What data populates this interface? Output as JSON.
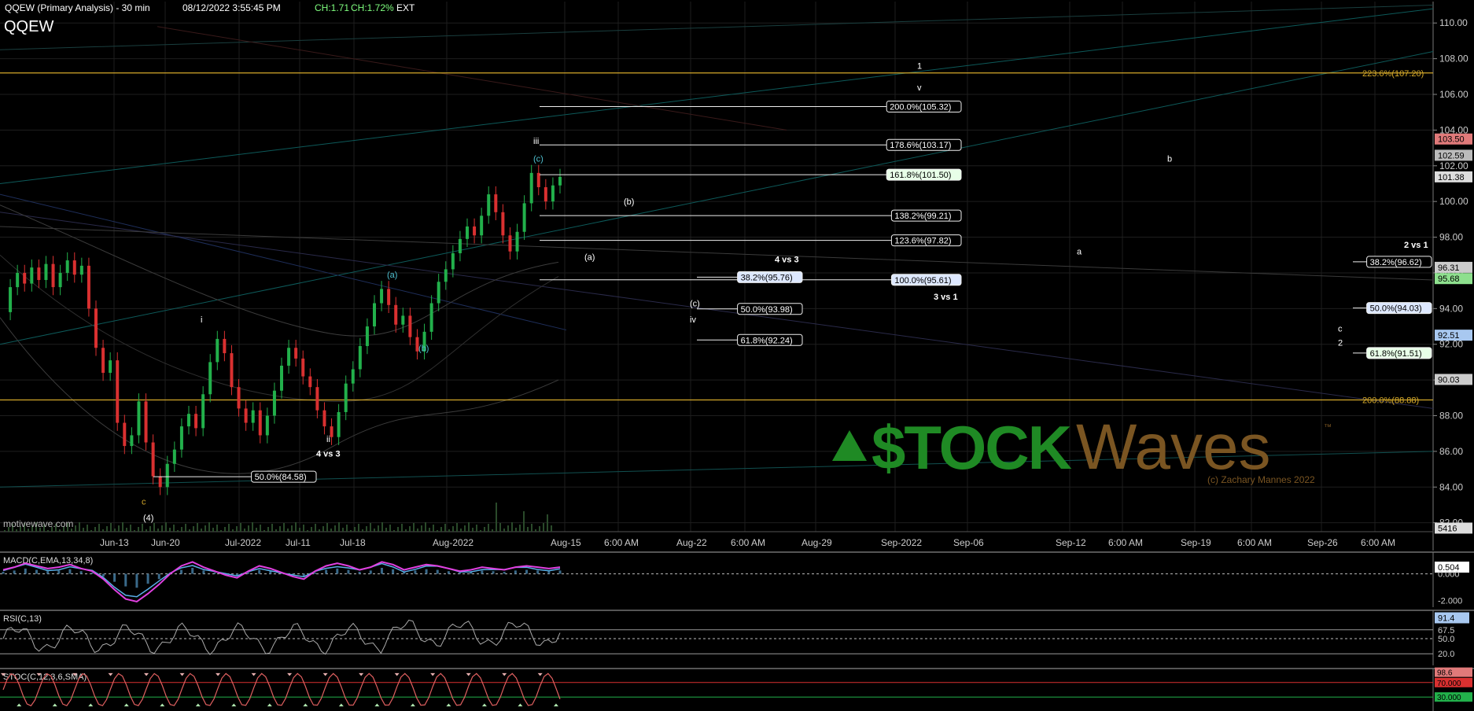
{
  "header": {
    "title": "QQEW (Primary Analysis) - 30 min",
    "timestamp": "08/12/2022 3:55:45 PM",
    "change_abs": "CH:1.71",
    "change_pct": "CH:1.72%",
    "session": "EXT",
    "symbol": "QQEW"
  },
  "watermark": {
    "credit": "motivewave.com",
    "brand_left": "$TOCK",
    "brand_right": "Waves",
    "trademark": "™",
    "copyright": "(c) Zachary Mannes 2022"
  },
  "colors": {
    "background": "#000000",
    "up": "#22b04b",
    "down": "#d93030",
    "fib_gold": "#d4a82a",
    "cyan_label": "#4fc0d0",
    "brand_green": "#1f8a24",
    "brand_brown": "#7a5522",
    "macd": "#e040e0",
    "macd_signal": "#5aaee8"
  },
  "chart_data": [
    {
      "type": "line",
      "name": "price",
      "x_ticks": [
        "Jun-13",
        "Jun-20",
        "Jul-2022",
        "Jul-11",
        "Jul-18",
        "Aug-2022",
        "Aug-15",
        "6:00 AM",
        "Aug-22",
        "6:00 AM",
        "Aug-29",
        "Sep-2022",
        "Sep-06",
        "Sep-12",
        "6:00 AM",
        "Sep-19",
        "6:00 AM",
        "Sep-26",
        "6:00 AM"
      ],
      "y_ticks": [
        82,
        84,
        86,
        88,
        90,
        92,
        94,
        96,
        98,
        100,
        102,
        104,
        106,
        108,
        110
      ],
      "y_tick_labels": [
        "82.00",
        "84.00",
        "86.00",
        "88.00",
        "90.00",
        "92.00",
        "94.00",
        "96.00",
        "98.00",
        "100.00",
        "102.00",
        "104.00",
        "106.00",
        "108.00",
        "110.00"
      ],
      "ylim": [
        81.5,
        111.2
      ],
      "axis_badges": [
        {
          "label": "103.50",
          "value": 103.5,
          "bg": "#e07a7a",
          "fg": "#000000"
        },
        {
          "label": "102.59",
          "value": 102.59,
          "bg": "#bbbbbb",
          "fg": "#000000"
        },
        {
          "label": "101.38",
          "value": 101.38,
          "bg": "#dddddd",
          "fg": "#000000"
        },
        {
          "label": "96.31",
          "value": 96.31,
          "bg": "#cccccc",
          "fg": "#000000"
        },
        {
          "label": "95.68",
          "value": 95.68,
          "bg": "#8ee08e",
          "fg": "#000000"
        },
        {
          "label": "92.51",
          "value": 92.51,
          "bg": "#a8c8f0",
          "fg": "#000000"
        },
        {
          "label": "90.03",
          "value": 90.03,
          "bg": "#cccccc",
          "fg": "#000000"
        },
        {
          "label": "5416",
          "value": 81.7,
          "bg": "#dddddd",
          "fg": "#000000"
        }
      ],
      "horizontal_levels": [
        {
          "label": "223.6%(107.20)",
          "value": 107.2,
          "color": "#d4a82a"
        },
        {
          "label": "200.0%(88.88)",
          "value": 88.88,
          "color": "#d4a82a"
        }
      ],
      "fib_levels": [
        {
          "label": "200.0%(105.32)",
          "value": 105.32
        },
        {
          "label": "178.6%(103.17)",
          "value": 103.17
        },
        {
          "label": "161.8%(101.50)",
          "value": 101.5
        },
        {
          "label": "138.2%(99.21)",
          "value": 99.21
        },
        {
          "label": "123.6%(97.82)",
          "value": 97.82
        },
        {
          "label": "100.0%(95.61)",
          "value": 95.61
        },
        {
          "label": "38.2%(95.76)",
          "value": 95.76
        },
        {
          "label": "50.0%(93.98)",
          "value": 93.98
        },
        {
          "label": "61.8%(92.24)",
          "value": 92.24
        },
        {
          "label": "50.0%(84.58)",
          "value": 84.58
        },
        {
          "label": "38.2%(96.62)",
          "value": 96.62
        },
        {
          "label": "50.0%(94.03)",
          "value": 94.03
        },
        {
          "label": "61.8%(91.51)",
          "value": 91.51
        }
      ],
      "wave_labels": [
        "1",
        "v",
        "iii",
        "(c)",
        "(b)",
        "(a)",
        "(a)",
        "(b)",
        "i",
        "ii",
        "c",
        "(4)",
        "(c)",
        "iv",
        "b",
        "a",
        "c",
        "2"
      ],
      "text_annotations": [
        "4 vs 3",
        "3 vs 1",
        "4 vs 3",
        "2 vs 1"
      ],
      "price_path": [
        {
          "t": 0,
          "v": 93.8
        },
        {
          "t": 1,
          "v": 95.2
        },
        {
          "t": 2,
          "v": 96.0
        },
        {
          "t": 3,
          "v": 95.4
        },
        {
          "t": 4,
          "v": 96.3
        },
        {
          "t": 5,
          "v": 95.6
        },
        {
          "t": 6,
          "v": 96.5
        },
        {
          "t": 7,
          "v": 95.2
        },
        {
          "t": 8,
          "v": 96.0
        },
        {
          "t": 9,
          "v": 96.7
        },
        {
          "t": 10,
          "v": 95.9
        },
        {
          "t": 11,
          "v": 96.4
        },
        {
          "t": 12,
          "v": 94.0
        },
        {
          "t": 13,
          "v": 91.8
        },
        {
          "t": 14,
          "v": 90.4
        },
        {
          "t": 15,
          "v": 91.1
        },
        {
          "t": 16,
          "v": 87.6
        },
        {
          "t": 17,
          "v": 86.3
        },
        {
          "t": 18,
          "v": 86.9
        },
        {
          "t": 19,
          "v": 88.8
        },
        {
          "t": 20,
          "v": 86.5
        },
        {
          "t": 21,
          "v": 84.6
        },
        {
          "t": 22,
          "v": 84.0
        },
        {
          "t": 23,
          "v": 85.3
        },
        {
          "t": 24,
          "v": 86.1
        },
        {
          "t": 25,
          "v": 87.4
        },
        {
          "t": 26,
          "v": 88.1
        },
        {
          "t": 27,
          "v": 87.3
        },
        {
          "t": 28,
          "v": 89.2
        },
        {
          "t": 29,
          "v": 91.0
        },
        {
          "t": 30,
          "v": 92.3
        },
        {
          "t": 31,
          "v": 91.5
        },
        {
          "t": 32,
          "v": 89.6
        },
        {
          "t": 33,
          "v": 88.4
        },
        {
          "t": 34,
          "v": 87.6
        },
        {
          "t": 35,
          "v": 88.3
        },
        {
          "t": 36,
          "v": 86.9
        },
        {
          "t": 37,
          "v": 88.0
        },
        {
          "t": 38,
          "v": 89.4
        },
        {
          "t": 39,
          "v": 90.8
        },
        {
          "t": 40,
          "v": 91.8
        },
        {
          "t": 41,
          "v": 91.2
        },
        {
          "t": 42,
          "v": 90.2
        },
        {
          "t": 43,
          "v": 89.6
        },
        {
          "t": 44,
          "v": 88.3
        },
        {
          "t": 45,
          "v": 87.4
        },
        {
          "t": 46,
          "v": 86.8
        },
        {
          "t": 47,
          "v": 88.2
        },
        {
          "t": 48,
          "v": 89.8
        },
        {
          "t": 49,
          "v": 90.6
        },
        {
          "t": 50,
          "v": 91.9
        },
        {
          "t": 51,
          "v": 93.0
        },
        {
          "t": 52,
          "v": 94.3
        },
        {
          "t": 53,
          "v": 95.1
        },
        {
          "t": 54,
          "v": 94.2
        },
        {
          "t": 55,
          "v": 93.1
        },
        {
          "t": 56,
          "v": 93.6
        },
        {
          "t": 57,
          "v": 92.4
        },
        {
          "t": 58,
          "v": 91.6
        },
        {
          "t": 59,
          "v": 92.7
        },
        {
          "t": 60,
          "v": 94.3
        },
        {
          "t": 61,
          "v": 95.5
        },
        {
          "t": 62,
          "v": 96.2
        },
        {
          "t": 63,
          "v": 97.1
        },
        {
          "t": 64,
          "v": 97.9
        },
        {
          "t": 65,
          "v": 98.6
        },
        {
          "t": 66,
          "v": 98.1
        },
        {
          "t": 67,
          "v": 99.2
        },
        {
          "t": 68,
          "v": 100.4
        },
        {
          "t": 69,
          "v": 99.4
        },
        {
          "t": 70,
          "v": 98.1
        },
        {
          "t": 71,
          "v": 97.2
        },
        {
          "t": 72,
          "v": 98.3
        },
        {
          "t": 73,
          "v": 99.9
        },
        {
          "t": 74,
          "v": 101.6
        },
        {
          "t": 75,
          "v": 100.8
        },
        {
          "t": 76,
          "v": 100.0
        },
        {
          "t": 77,
          "v": 100.9
        },
        {
          "t": 78,
          "v": 101.38
        }
      ],
      "volume_note": "5416"
    },
    {
      "type": "line",
      "name": "macd",
      "title": "MACD(C,EMA,13,34,8)",
      "y_ticks_labels": [
        "0.504",
        "0.000",
        "-2.000"
      ],
      "values": [
        0.3,
        0.5,
        0.8,
        0.6,
        0.4,
        0.5,
        0.7,
        0.4,
        0.2,
        -0.4,
        -1.2,
        -1.9,
        -2.1,
        -1.5,
        -0.8,
        0.0,
        0.6,
        0.9,
        0.5,
        0.2,
        -0.1,
        -0.3,
        0.2,
        0.6,
        0.4,
        0.1,
        -0.2,
        -0.4,
        0.2,
        0.6,
        0.8,
        0.6,
        0.3,
        0.5,
        0.9,
        0.7,
        0.3,
        0.5,
        0.7,
        0.6,
        0.4,
        0.2,
        0.3,
        0.5,
        0.4,
        0.3,
        0.5,
        0.6,
        0.5,
        0.4,
        0.504
      ]
    },
    {
      "type": "line",
      "name": "rsi",
      "title": "RSI(C,13)",
      "y_ticks_labels": [
        "91.4",
        "67.5",
        "50.0",
        "20.0"
      ]
    },
    {
      "type": "line",
      "name": "stoch",
      "title": "STOC(C,12,3,6,SMA)",
      "y_ticks_labels": [
        "98.6",
        "70.000",
        "30.000"
      ]
    }
  ]
}
